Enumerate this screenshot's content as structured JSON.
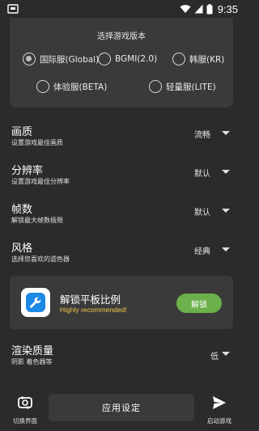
{
  "status_bar": {
    "time": "9:35"
  },
  "version_card": {
    "title": "选择游戏版本",
    "options": [
      {
        "label": "国际服(Global)",
        "selected": true
      },
      {
        "label": "BGMI(2.0)",
        "selected": false
      },
      {
        "label": "韩服(KR)",
        "selected": false
      },
      {
        "label": "体验服(BETA)",
        "selected": false
      },
      {
        "label": "轻量服(LITE)",
        "selected": false
      }
    ]
  },
  "settings": [
    {
      "title": "画质",
      "subtitle": "设置游戏最佳画质",
      "value": "流畅"
    },
    {
      "title": "分辨率",
      "subtitle": "设置游戏最佳分辨率",
      "value": "默认"
    },
    {
      "title": "帧数",
      "subtitle": "解锁最大帧数极限",
      "value": "默认"
    },
    {
      "title": "风格",
      "subtitle": "选择您喜欢的滤色器",
      "value": "经典"
    }
  ],
  "promo": {
    "title": "解锁平板比例",
    "subtitle": "Highly recommended!",
    "button_label": "解锁",
    "button_color": "#6bb04a",
    "subtitle_color": "#f2c84b"
  },
  "render_quality": {
    "title": "渲染质量",
    "subtitle": "阴影 着色器等",
    "value": "低"
  },
  "bottom_bar": {
    "switch_label": "切换界面",
    "apply_label": "应用设定",
    "launch_label": "启动游戏"
  }
}
